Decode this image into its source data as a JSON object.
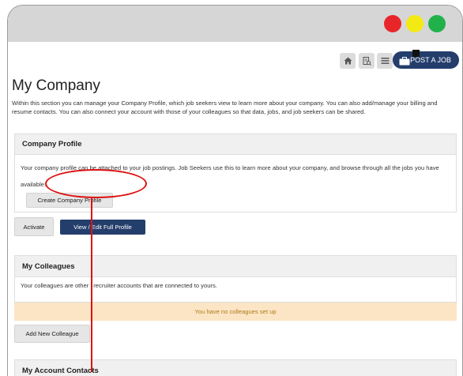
{
  "window": {
    "buttons": [
      {
        "name": "close",
        "color": "#e8262a"
      },
      {
        "name": "minimize",
        "color": "#f4ea13"
      },
      {
        "name": "maximize",
        "color": "#21b14a"
      }
    ]
  },
  "toolbar": {
    "icons": [
      "home-icon",
      "document-search-icon",
      "list-icon"
    ],
    "post_job_label": "POST A JOB"
  },
  "page": {
    "title": "My Company",
    "intro": "Within this section you can manage your Company Profile, which job seekers view to learn more about your company. You can also add/manage your billing and resume contacts. You can also connect your account with those of your colleagues so that data, jobs, and job seekers can be shared."
  },
  "company_profile": {
    "heading": "Company Profile",
    "description": "Your company profile can be attached to your job postings. Job Seekers use this to learn more about your company, and browse through all the jobs you have available.",
    "create_button": "Create Company Profile",
    "activate_button": "Activate",
    "view_edit_button": "View / Edit Full Profile"
  },
  "colleagues": {
    "heading": "My Colleagues",
    "description_1": "Your colleagues are other",
    "description_2": "recruiter accounts that are connected to yours.",
    "empty_notice": "You have no colleagues set up",
    "add_button": "Add New Colleague"
  },
  "account_contacts": {
    "heading": "My Account Contacts"
  },
  "colors": {
    "accent": "#243e6c",
    "annotation": "#dd1111",
    "notice_bg": "#fbe5c4"
  }
}
